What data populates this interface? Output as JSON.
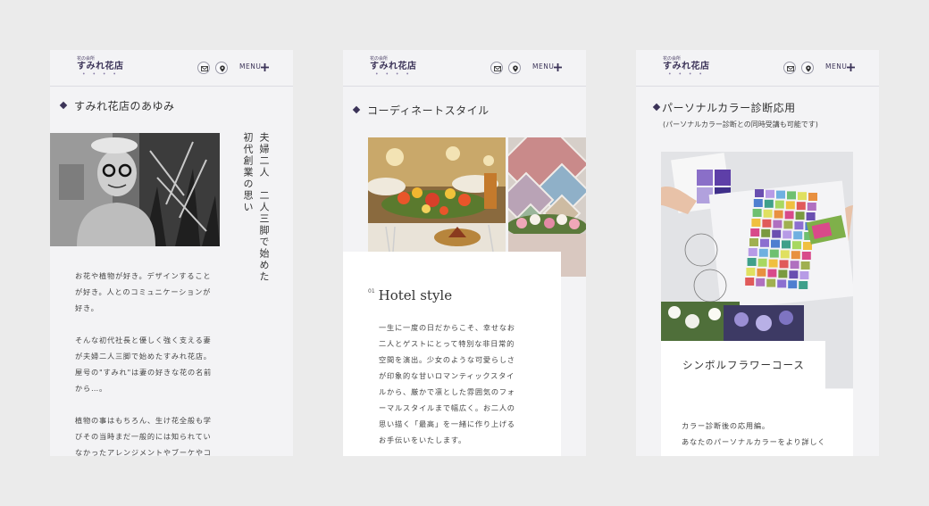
{
  "header": {
    "logo_small": "花の会所",
    "logo_main": "すみれ花店",
    "logo_dots": "• • • •",
    "menu_label": "MENU"
  },
  "screen1": {
    "title": "すみれ花店のあゆみ",
    "vertical_lines": [
      "夫婦二人　二人三脚で始めた",
      "初代創業の思い"
    ],
    "paragraphs": [
      [
        "お花や植物が好き。デザインすること",
        "が好き。人とのコミュニケーションが",
        "好き。"
      ],
      [
        "そんな初代社長と優しく強く支える妻",
        "が夫婦二人三脚で始めたすみれ花店。",
        "屋号の\"すみれ\"は妻の好きな花の名前",
        "から…。"
      ],
      [
        "植物の事はもちろん、生け花全般も学",
        "びその当時まだ一般的には知られてい",
        "なかったアレンジメントやブーケやコ"
      ]
    ]
  },
  "screen2": {
    "title": "コーディネートスタイル",
    "card_number": "01",
    "card_title": "Hotel style",
    "lines": [
      "一生に一度の日だからこそ、幸せなお",
      "二人とゲストにとって特別な非日常的",
      "空間を演出。少女のような可愛らしさ",
      "が印象的な甘いロマンティックスタイ",
      "ルから、厳かで凛とした雰囲気のフォ",
      "ーマルスタイルまで幅広く。お二人の",
      "思い描く「最高」を一緒に作り上げる",
      "お手伝いをいたします。"
    ]
  },
  "screen3": {
    "title": "パーソナルカラー診断応用",
    "note": "(パーソナルカラー診断との同時受講も可能です)",
    "course_tag": "シンボルフラワーコース",
    "lines": [
      "カラー診断後の応用編。",
      "あなたのパーソナルカラーをより詳しく"
    ]
  },
  "colors": {
    "accent": "#3b3358",
    "panel_bg": "#f3f3f5",
    "page_bg": "#ebebeb"
  }
}
